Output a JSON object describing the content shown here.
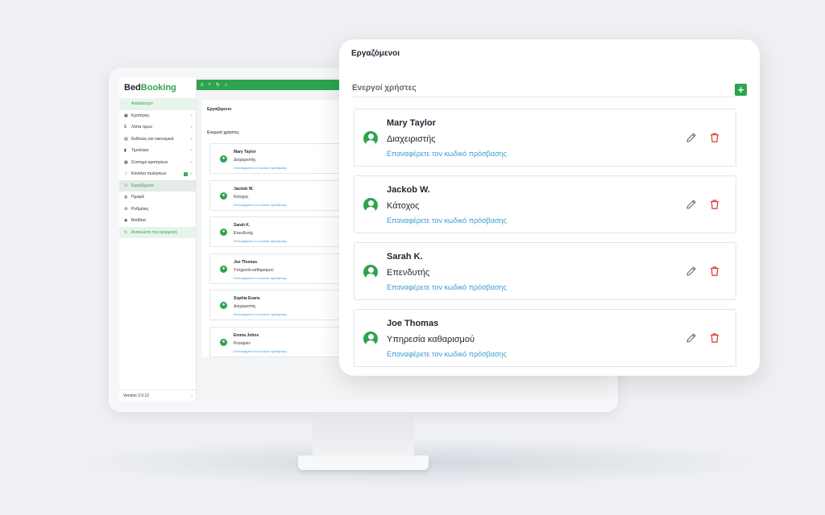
{
  "app": {
    "logo_part1": "Bed",
    "logo_part2": "Booking",
    "version": "Version 2.9.12"
  },
  "sidebar": {
    "items": [
      {
        "label": "Ασφάλιστρο",
        "icon": "shield-icon",
        "glyph": "◌"
      },
      {
        "label": "Κρατήσεις",
        "icon": "calendar-icon",
        "glyph": "▣"
      },
      {
        "label": "Λίστα τιμών",
        "icon": "dollar-icon",
        "glyph": "$"
      },
      {
        "label": "Εκθέσεις και οικονομικά",
        "icon": "chart-icon",
        "glyph": "▤"
      },
      {
        "label": "Τιμολόγια",
        "icon": "file-icon",
        "glyph": "▮"
      },
      {
        "label": "Σύστημα κρατήσεων",
        "icon": "grid-icon",
        "glyph": "▦"
      },
      {
        "label": "Κανάλια πωλήσεων",
        "icon": "star-icon",
        "glyph": "☆",
        "badge": "1"
      },
      {
        "label": "Εργαζόμενοι",
        "icon": "users-icon",
        "glyph": "⚇"
      },
      {
        "label": "Προφίλ",
        "icon": "profile-icon",
        "glyph": "◍"
      },
      {
        "label": "Ρυθμίσεις",
        "icon": "gear-icon",
        "glyph": "⚙"
      },
      {
        "label": "Βοήθεια",
        "icon": "help-icon",
        "glyph": "◉"
      },
      {
        "label": "Ανανεώστε την εφαρμογή",
        "icon": "refresh-icon",
        "glyph": "↻"
      }
    ]
  },
  "topbar": {
    "menu_glyph": "≡",
    "search_glyph": "⌕",
    "refresh_glyph": "↻",
    "home_glyph": "⌂"
  },
  "inner": {
    "title": "Εργαζόμενοι",
    "section": "Ενεργοί χρήστες",
    "users": [
      {
        "name": "Mary Taylor",
        "role": "Διαχειριστής",
        "link": "Επαναφέρετε τον κωδικό πρόσβασης"
      },
      {
        "name": "Jackob W.",
        "role": "Κάτοχος",
        "link": "Επαναφέρετε τον κωδικό πρόσβασης"
      },
      {
        "name": "Sarah K.",
        "role": "Επενδυτής",
        "link": "Επαναφέρετε τον κωδικό πρόσβασης"
      },
      {
        "name": "Joe Thomas",
        "role": "Υπηρεσία καθαρισμού",
        "link": "Επαναφέρετε τον κωδικό πρόσβασης"
      },
      {
        "name": "Sophia Evans",
        "role": "Διαχειριστής",
        "link": "Επαναφέρετε τον κωδικό πρόσβασης"
      },
      {
        "name": "Emma Johns",
        "role": "Ρεσεψιόν",
        "link": "Επαναφέρετε τον κωδικό πρόσβασης"
      }
    ]
  },
  "panel": {
    "title": "Εργαζόμενοι",
    "section": "Ενεργοί χρήστες",
    "add_label": "+",
    "users": [
      {
        "name": "Mary Taylor",
        "role": "Διαχειριστής",
        "link": "Επαναφέρετε τον κωδικό πρόσβασης"
      },
      {
        "name": "Jackob W.",
        "role": "Κάτοχος",
        "link": "Επαναφέρετε τον κωδικό πρόσβασης"
      },
      {
        "name": "Sarah K.",
        "role": "Επενδυτής",
        "link": "Επαναφέρετε τον κωδικό πρόσβασης"
      },
      {
        "name": "Joe Thomas",
        "role": "Υπηρεσία καθαρισμού",
        "link": "Επαναφέρετε τον κωδικό πρόσβασης"
      }
    ]
  },
  "colors": {
    "accent": "#2ea44f",
    "link": "#3a9bd5",
    "delete": "#e0443b",
    "edit": "#777777"
  }
}
